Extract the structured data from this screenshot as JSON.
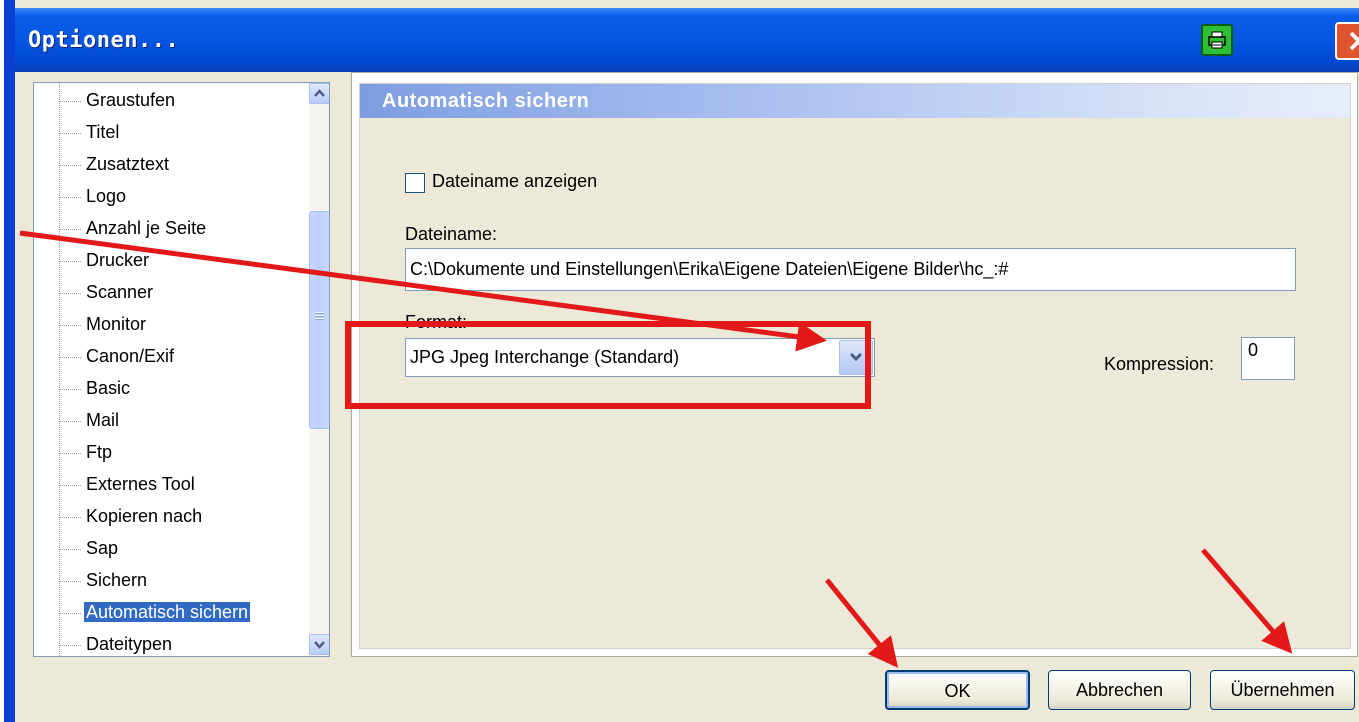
{
  "window": {
    "title": "Optionen..."
  },
  "titlebar": {
    "print_icon": "printer-icon",
    "close_icon": "close-icon",
    "close_color": "#e0532f"
  },
  "tree": {
    "items": [
      {
        "label": "Graustufen"
      },
      {
        "label": "Titel"
      },
      {
        "label": "Zusatztext"
      },
      {
        "label": "Logo"
      },
      {
        "label": "Anzahl je Seite"
      },
      {
        "label": "Drucker"
      },
      {
        "label": "Scanner"
      },
      {
        "label": "Monitor"
      },
      {
        "label": "Canon/Exif"
      },
      {
        "label": "Basic"
      },
      {
        "label": "Mail"
      },
      {
        "label": "Ftp"
      },
      {
        "label": "Externes Tool"
      },
      {
        "label": "Kopieren nach"
      },
      {
        "label": "Sap"
      },
      {
        "label": "Sichern"
      },
      {
        "label": "Automatisch sichern",
        "selected": true
      },
      {
        "label": "Dateitypen"
      }
    ],
    "selected_color": "#316ac5"
  },
  "panel": {
    "header": "Automatisch sichern",
    "show_filename_label": "Dateiname anzeigen",
    "show_filename_checked": false,
    "filename_label": "Dateiname:",
    "filename_value": "C:\\Dokumente und Einstellungen\\Erika\\Eigene Dateien\\Eigene Bilder\\hc_:#",
    "format_label": "Format:",
    "format_value": "JPG  Jpeg Interchange (Standard)",
    "compression_label": "Kompression:",
    "compression_value": "0"
  },
  "buttons": {
    "ok": "OK",
    "cancel": "Abbrechen",
    "apply": "Übernehmen"
  },
  "annotations": {
    "color": "#e31919"
  }
}
